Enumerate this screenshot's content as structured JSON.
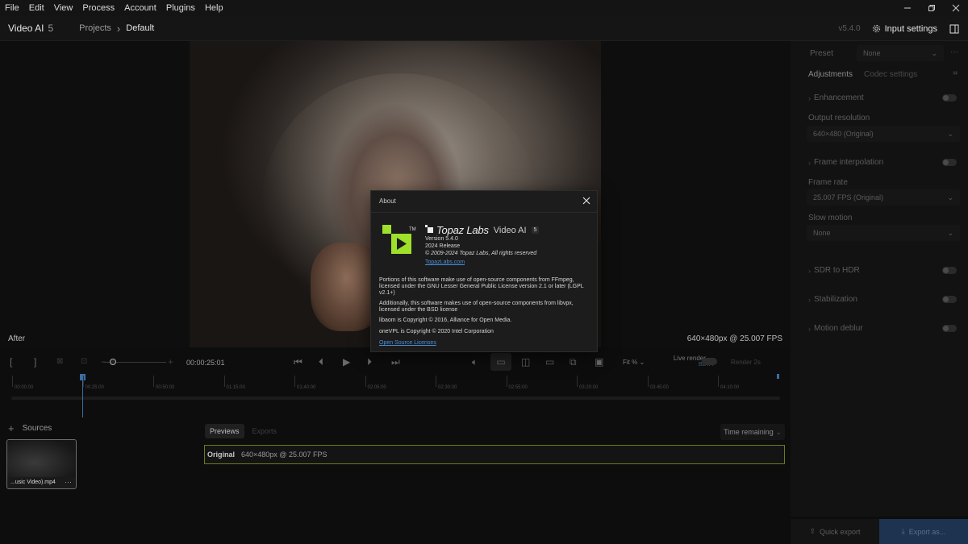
{
  "menubar": {
    "items": [
      "File",
      "Edit",
      "View",
      "Process",
      "Account",
      "Plugins",
      "Help"
    ]
  },
  "header": {
    "app_name": "Video AI",
    "app_version_badge": "5",
    "breadcrumb": [
      "Projects",
      "Default"
    ],
    "version": "v5.4.0",
    "input_settings_label": "Input settings"
  },
  "preview": {
    "left_label": "After",
    "right_label": "640×480px @ 25.007 FPS"
  },
  "right_panel": {
    "preset_label": "Preset",
    "preset_value": "None",
    "tabs": [
      "Adjustments",
      "Codec settings"
    ],
    "enhancement_label": "Enhancement",
    "output_resolution_label": "Output resolution",
    "output_resolution_value": "640×480 (Original)",
    "frame_interpolation_label": "Frame interpolation",
    "frame_rate_label": "Frame rate",
    "frame_rate_value": "25.007 FPS (Original)",
    "slow_motion_label": "Slow motion",
    "slow_motion_value": "None",
    "sdr_to_hdr_label": "SDR to HDR",
    "stabilization_label": "Stabilization",
    "motion_deblur_label": "Motion deblur"
  },
  "controls": {
    "timecode": "00:00:25:01",
    "fit_label": "Fit %",
    "live_render_label": "Live render",
    "live_render_badge": "BETA",
    "render_label": "Render 2s"
  },
  "timeline": {
    "ticks": [
      "00:00:00",
      "00:25:00",
      "00:50:00",
      "01:15:00",
      "01:40:00",
      "02:05:00",
      "02:30:00",
      "02:55:00",
      "03:20:00",
      "03:45:00",
      "04:10:00"
    ]
  },
  "sources": {
    "header": "Sources",
    "items": [
      {
        "name": "...usic Video).mp4"
      }
    ]
  },
  "previews": {
    "tabs": [
      "Previews",
      "Exports"
    ],
    "time_remaining": "Time remaining",
    "original_label": "Original",
    "original_value": "640×480px @ 25.007 FPS"
  },
  "footer": {
    "quick_export": "Quick export",
    "export_as": "Export as..."
  },
  "about": {
    "title": "About",
    "brand": "Topaz Labs",
    "product": "Video AI",
    "product_version_badge": "5",
    "version_line": "Version 5.4.0",
    "release_line": "2024 Release",
    "copyright_line": "© 2009-2024 Topaz Labs, All rights reserved",
    "website_link": "TopazLabs.com",
    "para1": "Portions of this software make use of open-source components from FFmpeg, licensed under the GNU Lesser General Public License version 2.1 or later (LGPL v2.1+)",
    "para2": "Additionally, this software makes use of open-source components from libvpx, licensed under the BSD license",
    "para3": "libaom is Copyright © 2016, Alliance for Open Media.",
    "para4": "oneVPL is Copyright © 2020 Intel Corporation",
    "licenses_link": "Open Source Licenses",
    "logo_tm": "TM"
  },
  "colors": {
    "accent_green": "#9ee02a",
    "link_blue": "#4a8ed8",
    "export_blue": "#1d3350"
  }
}
